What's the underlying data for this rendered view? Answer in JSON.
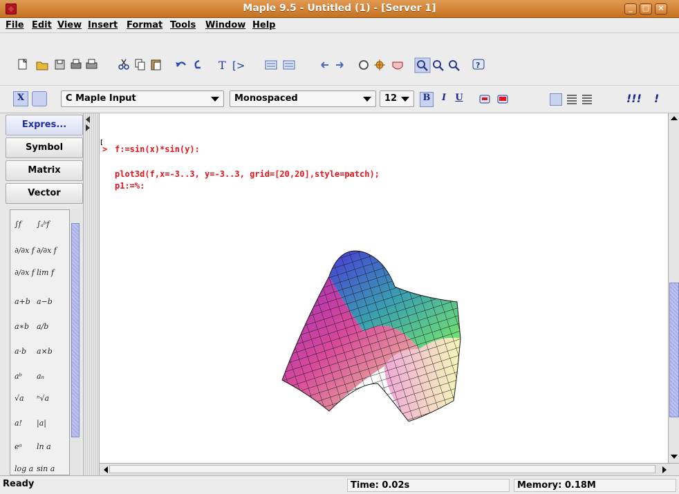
{
  "window": {
    "title": "Maple 9.5 - Untitled (1) - [Server 1]"
  },
  "menu": [
    "File",
    "Edit",
    "View",
    "Insert",
    "Format",
    "Tools",
    "Window",
    "Help"
  ],
  "toolbar_icons": [
    "new-icon",
    "open-icon",
    "save-icon",
    "print-preview-icon",
    "print-icon",
    "cut-icon",
    "copy-icon",
    "paste-icon",
    "undo-icon",
    "redo-icon",
    "text-mode-icon",
    "maple-input-icon",
    "insert-group-icon",
    "insert-section-icon",
    "back-icon",
    "forward-icon",
    "stop-icon",
    "debug-icon",
    "restart-icon",
    "zoom-100-icon",
    "zoom-150-icon",
    "zoom-200-icon",
    "help-icon"
  ],
  "format_bar": {
    "style_value": "C  Maple Input",
    "font_value": "Monospaced",
    "size_value": "12",
    "bold": "B",
    "italic": "I",
    "underline": "U",
    "exec_all": "!!!",
    "exec": "!"
  },
  "palette": {
    "tabs": [
      "Expres...",
      "Symbol",
      "Matrix",
      "Vector"
    ],
    "active_tab": "Expres...",
    "symbols": [
      "∫f",
      "∫ₐᵇf",
      "∂/∂x f",
      "∂/∂x f",
      "∂/∂x f",
      "lim f",
      "a+b",
      "a−b",
      "a∗b",
      "a/b",
      "a·b",
      "a×b",
      "aᵇ",
      "aₙ",
      "√a",
      "ⁿ√a",
      "a!",
      "|a|",
      "eᵃ",
      "ln a",
      "log a",
      "sin a"
    ]
  },
  "worksheet": {
    "prompt": ">",
    "lines": [
      "f:=sin(x)*sin(y):",
      "plot3d(f,x=-3..3, y=-3..3, grid=[20,20],style=patch);",
      "p1:=%:"
    ]
  },
  "status": {
    "state": "Ready",
    "time": "Time: 0.02s",
    "memory": "Memory: 0.18M"
  },
  "colors": {
    "title_bar": "#d07f32",
    "input_text": "#e8131a",
    "active_tab": "#1c2ea8"
  }
}
